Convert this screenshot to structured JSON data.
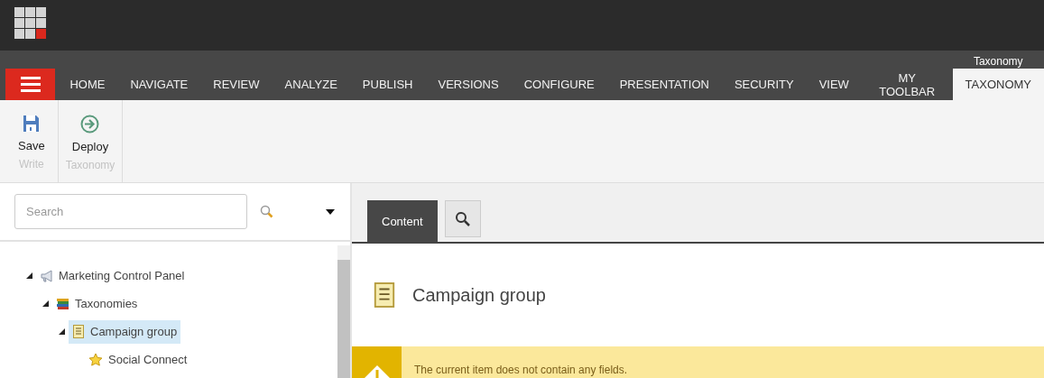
{
  "tabs": [
    {
      "label": "HOME",
      "selected": false
    },
    {
      "label": "NAVIGATE",
      "selected": false
    },
    {
      "label": "REVIEW",
      "selected": false
    },
    {
      "label": "ANALYZE",
      "selected": false
    },
    {
      "label": "PUBLISH",
      "selected": false
    },
    {
      "label": "VERSIONS",
      "selected": false
    },
    {
      "label": "CONFIGURE",
      "selected": false
    },
    {
      "label": "PRESENTATION",
      "selected": false
    },
    {
      "label": "SECURITY",
      "selected": false
    },
    {
      "label": "VIEW",
      "selected": false
    },
    {
      "label": "MY TOOLBAR",
      "selected": false
    },
    {
      "label": "TAXONOMY",
      "selected": true,
      "context": "Taxonomy"
    }
  ],
  "ribbon": {
    "groups": [
      {
        "label": "Write",
        "buttons": [
          {
            "kind": "save",
            "label": "Save"
          }
        ]
      },
      {
        "label": "Taxonomy",
        "buttons": [
          {
            "kind": "deploy",
            "label": "Deploy"
          }
        ]
      }
    ]
  },
  "search": {
    "placeholder": "Search"
  },
  "tree": [
    {
      "kind": "control-panel",
      "label": "Marketing Control Panel",
      "expanded": true,
      "selected": false,
      "children": [
        {
          "kind": "books",
          "label": "Taxonomies",
          "expanded": true,
          "selected": false,
          "children": [
            {
              "kind": "template",
              "label": "Campaign group",
              "expanded": true,
              "selected": true,
              "children": [
                {
                  "kind": "star",
                  "label": "Social Connect",
                  "selected": false
                }
              ]
            }
          ]
        }
      ]
    }
  ],
  "editor": {
    "tabs": [
      {
        "kind": "text",
        "label": "Content",
        "selected": true
      },
      {
        "kind": "search",
        "selected": false
      }
    ],
    "title": "Campaign group",
    "warning": "The current item does not contain any fields."
  }
}
